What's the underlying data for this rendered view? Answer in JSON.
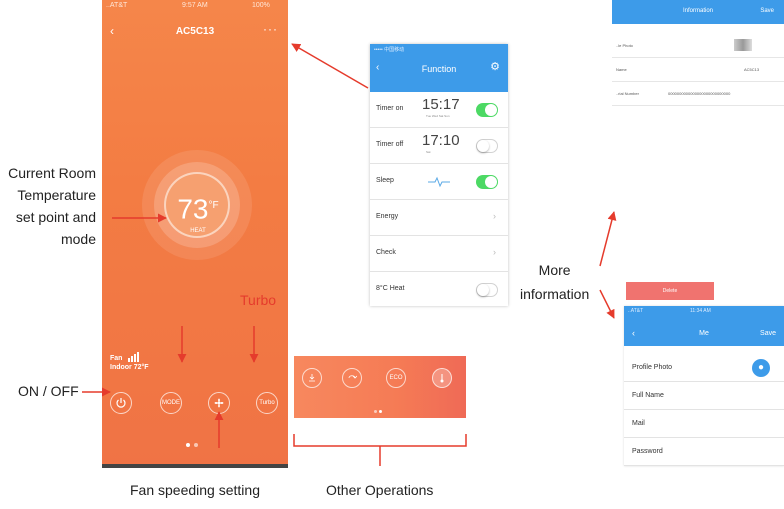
{
  "main_app": {
    "status_left": "..AT&T",
    "status_time": "9:57 AM",
    "status_right": "100%",
    "title": "AC5C13",
    "back_icon": "chevron-left",
    "more_icon": "more-dots",
    "temperature": "73",
    "temp_unit": "°F",
    "mode": "HEAT",
    "fan_label": "Fan",
    "indoor_label": "Indoor 72°F",
    "buttons": [
      "MODE",
      "Turbo"
    ],
    "power_icon": "power-icon",
    "fan_icon": "fan-icon"
  },
  "function_screen": {
    "status": "••••• 中国移动",
    "title": "Function",
    "rows": [
      {
        "label": "Timer on",
        "time": "15:17",
        "sub": "Tue Wed Sat Sun",
        "toggle": true
      },
      {
        "label": "Timer off",
        "time": "17:10",
        "sub": "Sat",
        "toggle": false
      },
      {
        "label": "Sleep",
        "toggle": true
      },
      {
        "label": "Energy"
      },
      {
        "label": "Check"
      },
      {
        "label": "8°C Heat",
        "toggle": false
      }
    ]
  },
  "other_operations": {
    "buttons": [
      "ECO"
    ]
  },
  "info_screen": {
    "title": "Information",
    "save": "Save",
    "rows": [
      {
        "label": "..le Photo"
      },
      {
        "label": "Name",
        "value": "AC5C13"
      },
      {
        "label": "..rial Number",
        "value": "0000000000000000000000000000"
      }
    ]
  },
  "me_screen": {
    "delete_label": "Delete",
    "status_left": "..AT&T",
    "status_time": "11:34 AM",
    "title": "Me",
    "save": "Save",
    "rows": [
      "Profile Photo",
      "Full Name",
      "Mail",
      "Password"
    ]
  },
  "annotations": {
    "current_room": [
      "Current Room",
      "Temperature",
      "set point and",
      "mode"
    ],
    "turbo": "Turbo",
    "on_off": "ON / OFF",
    "fan_speed": "Fan speeding setting",
    "other_ops": "Other Operations",
    "more_info": [
      "More",
      "information"
    ]
  }
}
